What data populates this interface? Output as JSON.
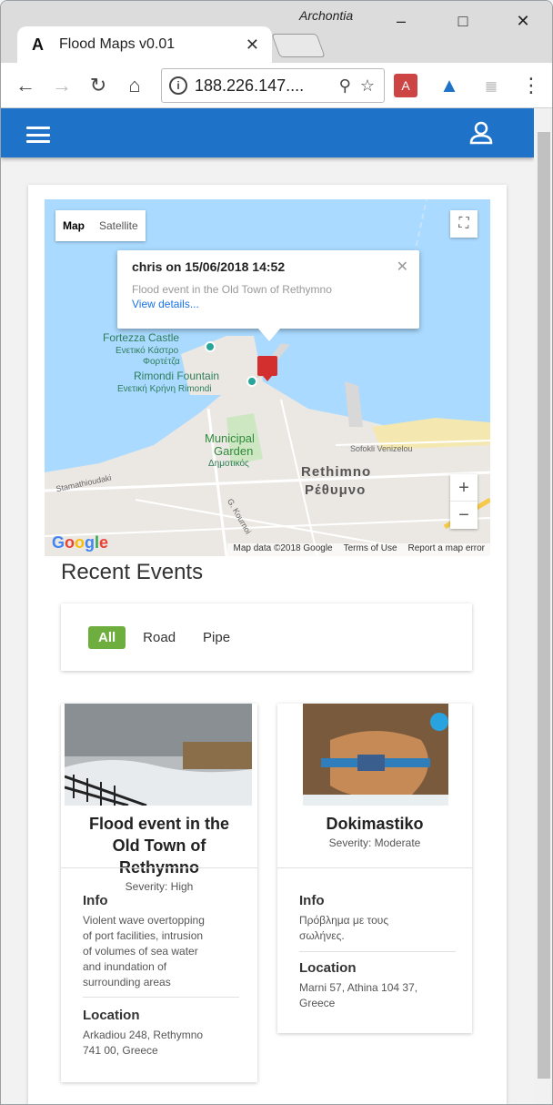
{
  "browser": {
    "profile_name": "Archontia",
    "tab_title": "Flood Maps v0.01",
    "url": "188.226.147...."
  },
  "map": {
    "type_map": "Map",
    "type_satellite": "Satellite",
    "infowindow": {
      "title": "chris on 15/06/2018 14:52",
      "description": "Flood event in the Old Town of Rethymno",
      "link": "View details..."
    },
    "labels": {
      "fortezza": "Fortezza Castle",
      "fortezza_gr1": "Ενετικό Κάστρο",
      "fortezza_gr2": "Φορτέτζα",
      "rimondi": "Rimondi Fountain",
      "rimondi_gr": "Ενετική Κρήνη Rimondi",
      "garden1": "Municipal",
      "garden2": "Garden",
      "garden_gr": "Δημοτικός",
      "city": "Rethimno",
      "city_gr": "Ρέθυμνο",
      "street1": "Sofokli Venizelou",
      "street2": "Stamathioudaki",
      "street3": "G. Kournoi"
    },
    "google": "Google",
    "attribution": [
      "Map data ©2018 Google",
      "Terms of Use",
      "Report a map error"
    ],
    "zoom_in": "+",
    "zoom_out": "−"
  },
  "events_section": {
    "title": "Recent Events",
    "filters": [
      "All",
      "Road",
      "Pipe"
    ],
    "active_filter": "All"
  },
  "events": [
    {
      "title_lines": [
        "Flood event in the",
        "Old Town of",
        "Rethymno"
      ],
      "severity": "Severity: High",
      "info_label": "Info",
      "info_lines": [
        "Violent wave overtopping",
        "of port facilities, intrusion",
        "of volumes of sea water",
        "and inundation of",
        "surrounding areas"
      ],
      "location_label": "Location",
      "location_lines": [
        "Arkadiou 248, Rethymno",
        "741 00, Greece"
      ]
    },
    {
      "title_lines": [
        "Dokimastiko"
      ],
      "severity": "Severity: Moderate",
      "info_label": "Info",
      "info_lines": [
        "Πρόβλημα με τους",
        "σωλήνες."
      ],
      "location_label": "Location",
      "location_lines": [
        "Marni 57, Athina 104 37,",
        "Greece"
      ]
    }
  ]
}
